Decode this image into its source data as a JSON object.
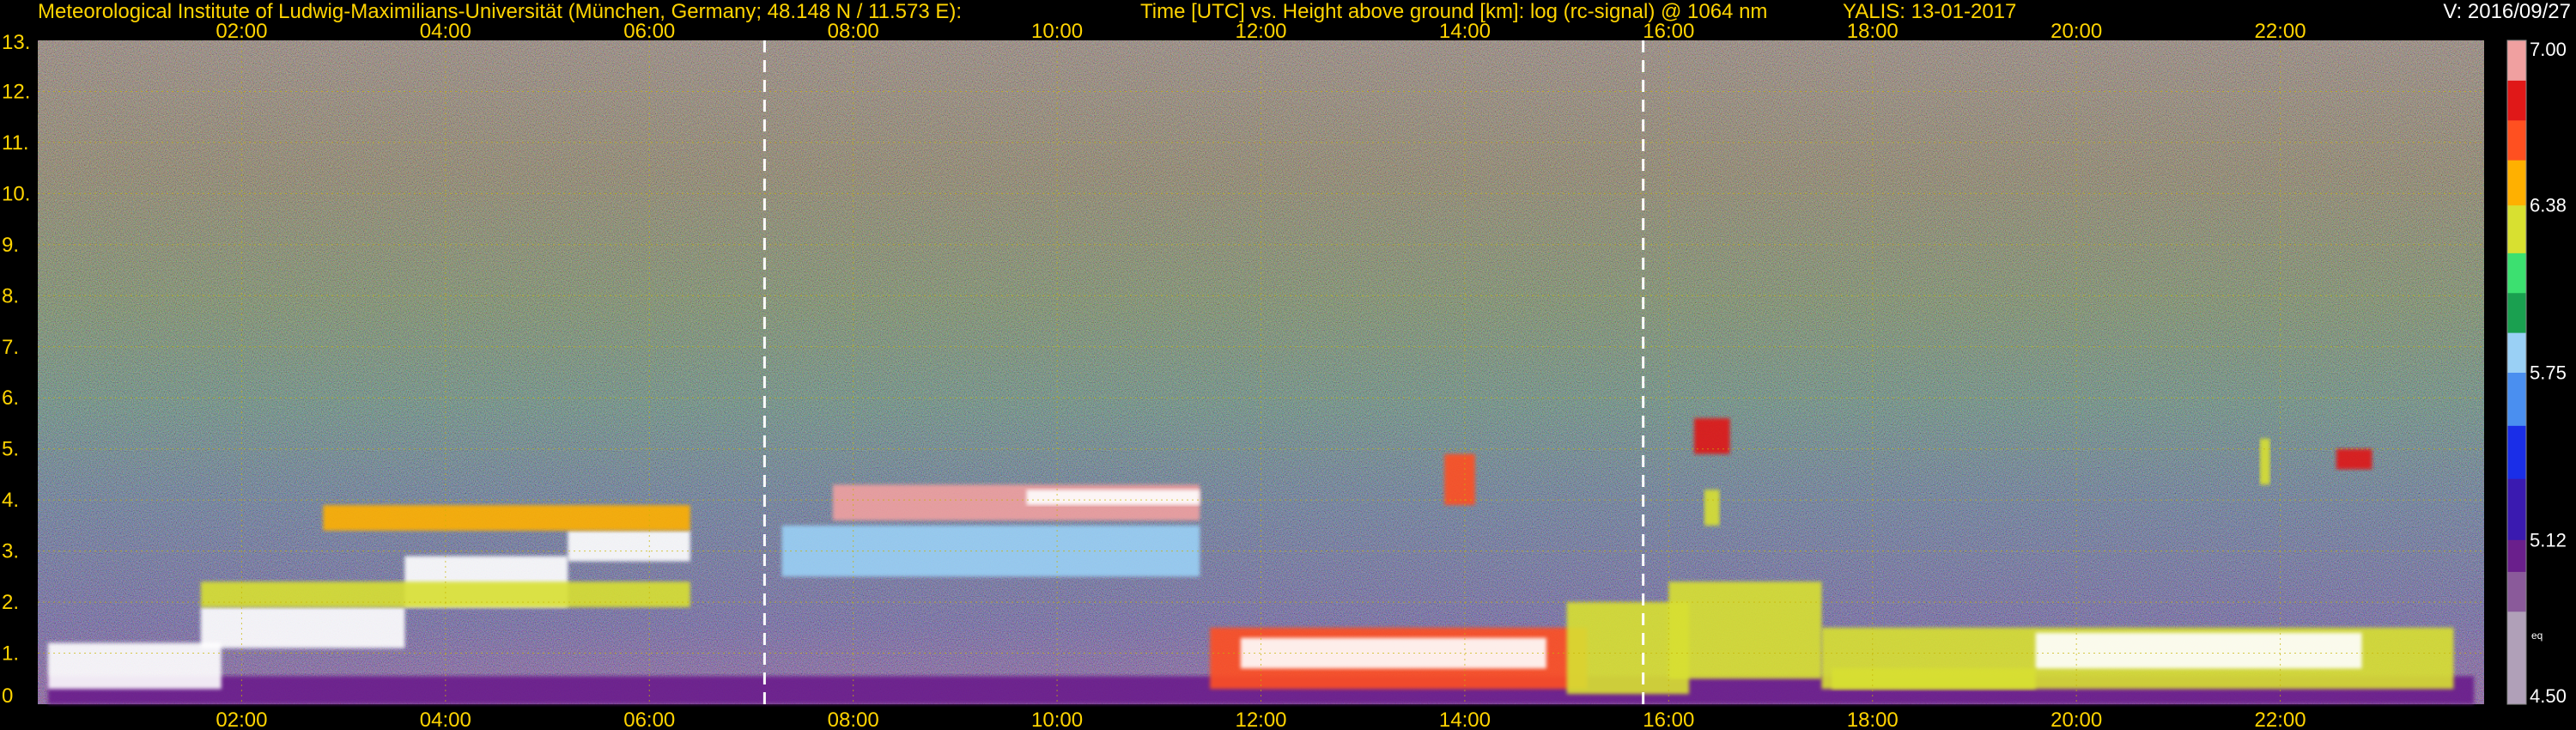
{
  "header": {
    "institute": "Meteorological Institute of Ludwig-Maximilians-Universität (München, Germany; 48.148 N / 11.573 E):",
    "axes_title": "Time [UTC] vs. Height above ground [km]: log (rc-signal) @ 1064 nm",
    "instrument": "YALIS: 13-01-2017",
    "version": "V: 2016/09/27"
  },
  "colors": {
    "background": "#000000",
    "header_text": "#ffd400",
    "tick_text": "#ffd400",
    "grid": "#c8b400",
    "marker_lines": "#ffffff"
  },
  "chart_data": {
    "type": "heatmap",
    "title": "Time [UTC] vs. Height above ground [km]: log (rc-signal) @ 1064 nm",
    "xlabel": "Time [UTC]",
    "ylabel": "Height above ground [km]",
    "x_range_hours": [
      0.0,
      24.0
    ],
    "ylim": [
      0,
      13
    ],
    "x_ticks": [
      "02:00",
      "04:00",
      "06:00",
      "08:00",
      "10:00",
      "12:00",
      "14:00",
      "16:00",
      "18:00",
      "20:00",
      "22:00"
    ],
    "x_tick_hours": [
      2,
      4,
      6,
      8,
      10,
      12,
      14,
      16,
      18,
      20,
      22
    ],
    "y_ticks": [
      "0",
      "1.",
      "2.",
      "3.",
      "4.",
      "5.",
      "6.",
      "7.",
      "8.",
      "9.",
      "10.",
      "11.",
      "12.",
      "13."
    ],
    "y_tick_values": [
      0,
      1,
      2,
      3,
      4,
      5,
      6,
      7,
      8,
      9,
      10,
      11,
      12,
      13
    ],
    "grid": true,
    "vertical_marker_hours": [
      7.13,
      15.75
    ],
    "colorbar": {
      "min": 4.5,
      "max": 7.0,
      "labels": [
        "7.00",
        "6.38",
        "5.75",
        "5.12",
        "4.50"
      ],
      "label_values": [
        7.0,
        6.38,
        5.75,
        5.12,
        4.5
      ],
      "extra_label": "eq",
      "stops": [
        {
          "value": 4.5,
          "color": "#b0a0b8"
        },
        {
          "value": 4.85,
          "color": "#8a5a9a"
        },
        {
          "value": 5.0,
          "color": "#6a1f8c"
        },
        {
          "value": 5.12,
          "color": "#3a1ab0"
        },
        {
          "value": 5.35,
          "color": "#1a2ee8"
        },
        {
          "value": 5.55,
          "color": "#4a8ff0"
        },
        {
          "value": 5.75,
          "color": "#9ad0f5"
        },
        {
          "value": 5.9,
          "color": "#1aa050"
        },
        {
          "value": 6.05,
          "color": "#3ce070"
        },
        {
          "value": 6.2,
          "color": "#d8e030"
        },
        {
          "value": 6.38,
          "color": "#ffb000"
        },
        {
          "value": 6.55,
          "color": "#ff5020"
        },
        {
          "value": 6.7,
          "color": "#e01818"
        },
        {
          "value": 6.85,
          "color": "#f0a0a0"
        },
        {
          "value": 7.0,
          "color": "#ffffff"
        }
      ]
    }
  }
}
